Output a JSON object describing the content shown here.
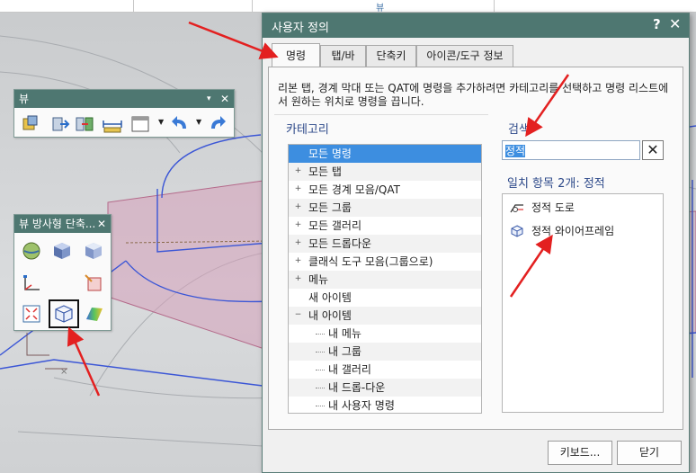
{
  "top_strip": {
    "tab_label": "뷰"
  },
  "view_toolbar": {
    "title": "뷰",
    "menu_glyph": "▾",
    "close_glyph": "✕",
    "icons": [
      "view-fit-icon",
      "view-front-icon",
      "view-side-icon",
      "measure-ruler-icon",
      "view-layout-icon",
      "undo-icon",
      "redo-icon"
    ]
  },
  "radial_toolbar": {
    "title": "뷰 방사형 단축...",
    "close_glyph": "✕",
    "icons": [
      "sphere-shaded-icon",
      "cube-shaded-icon",
      "cube-light-icon",
      "axis-icon",
      "section-icon",
      "fit-icon",
      "static-wireframe-icon",
      "gradient-icon"
    ]
  },
  "dialog": {
    "title": "사용자 정의",
    "help_glyph": "?",
    "close_glyph": "✕",
    "tabs": [
      "명령",
      "탭/바",
      "단축키",
      "아이콘/도구 정보"
    ],
    "active_tab": "명령",
    "description": "리본 탭, 경계 막대 또는 QAT에 명령을 추가하려면 카테고리를 선택하고 명령 리스트에서 원하는 위치로 명령을 끕니다.",
    "category": {
      "title": "카테고리",
      "items": [
        {
          "label": "모든 명령",
          "expander": "",
          "indent": 0,
          "selected": true
        },
        {
          "label": "모든 탭",
          "expander": "+",
          "indent": 0
        },
        {
          "label": "모든 경계 모음/QAT",
          "expander": "+",
          "indent": 0
        },
        {
          "label": "모든 그룹",
          "expander": "+",
          "indent": 0
        },
        {
          "label": "모든 갤러리",
          "expander": "+",
          "indent": 0
        },
        {
          "label": "모든 드롭다운",
          "expander": "+",
          "indent": 0
        },
        {
          "label": "클래식 도구 모음(그룹으로)",
          "expander": "+",
          "indent": 0
        },
        {
          "label": "메뉴",
          "expander": "+",
          "indent": 0
        },
        {
          "label": "새 아이템",
          "expander": "",
          "indent": 0
        },
        {
          "label": "내 아이템",
          "expander": "−",
          "indent": 0
        },
        {
          "label": "내 메뉴",
          "expander": "",
          "indent": 1
        },
        {
          "label": "내 그룹",
          "expander": "",
          "indent": 1
        },
        {
          "label": "내 갤러리",
          "expander": "",
          "indent": 1
        },
        {
          "label": "내 드롭-다운",
          "expander": "",
          "indent": 1
        },
        {
          "label": "내 사용자 명령",
          "expander": "",
          "indent": 1
        }
      ]
    },
    "search": {
      "title": "검색",
      "value": "정적",
      "clear_glyph": "✕"
    },
    "results": {
      "title": "일치 항목 2개: 정적",
      "items": [
        {
          "label": "정적 도로",
          "icon": "static-road-icon"
        },
        {
          "label": "정적 와이어프레임",
          "icon": "static-wireframe-icon"
        }
      ]
    },
    "buttons": {
      "keyboard": "키보드...",
      "close": "닫기"
    }
  },
  "colors": {
    "title_bar": "#4e7771",
    "selection": "#3d8ee0",
    "group_title": "#2e4a8a",
    "annotation_arrow": "#e32020"
  }
}
